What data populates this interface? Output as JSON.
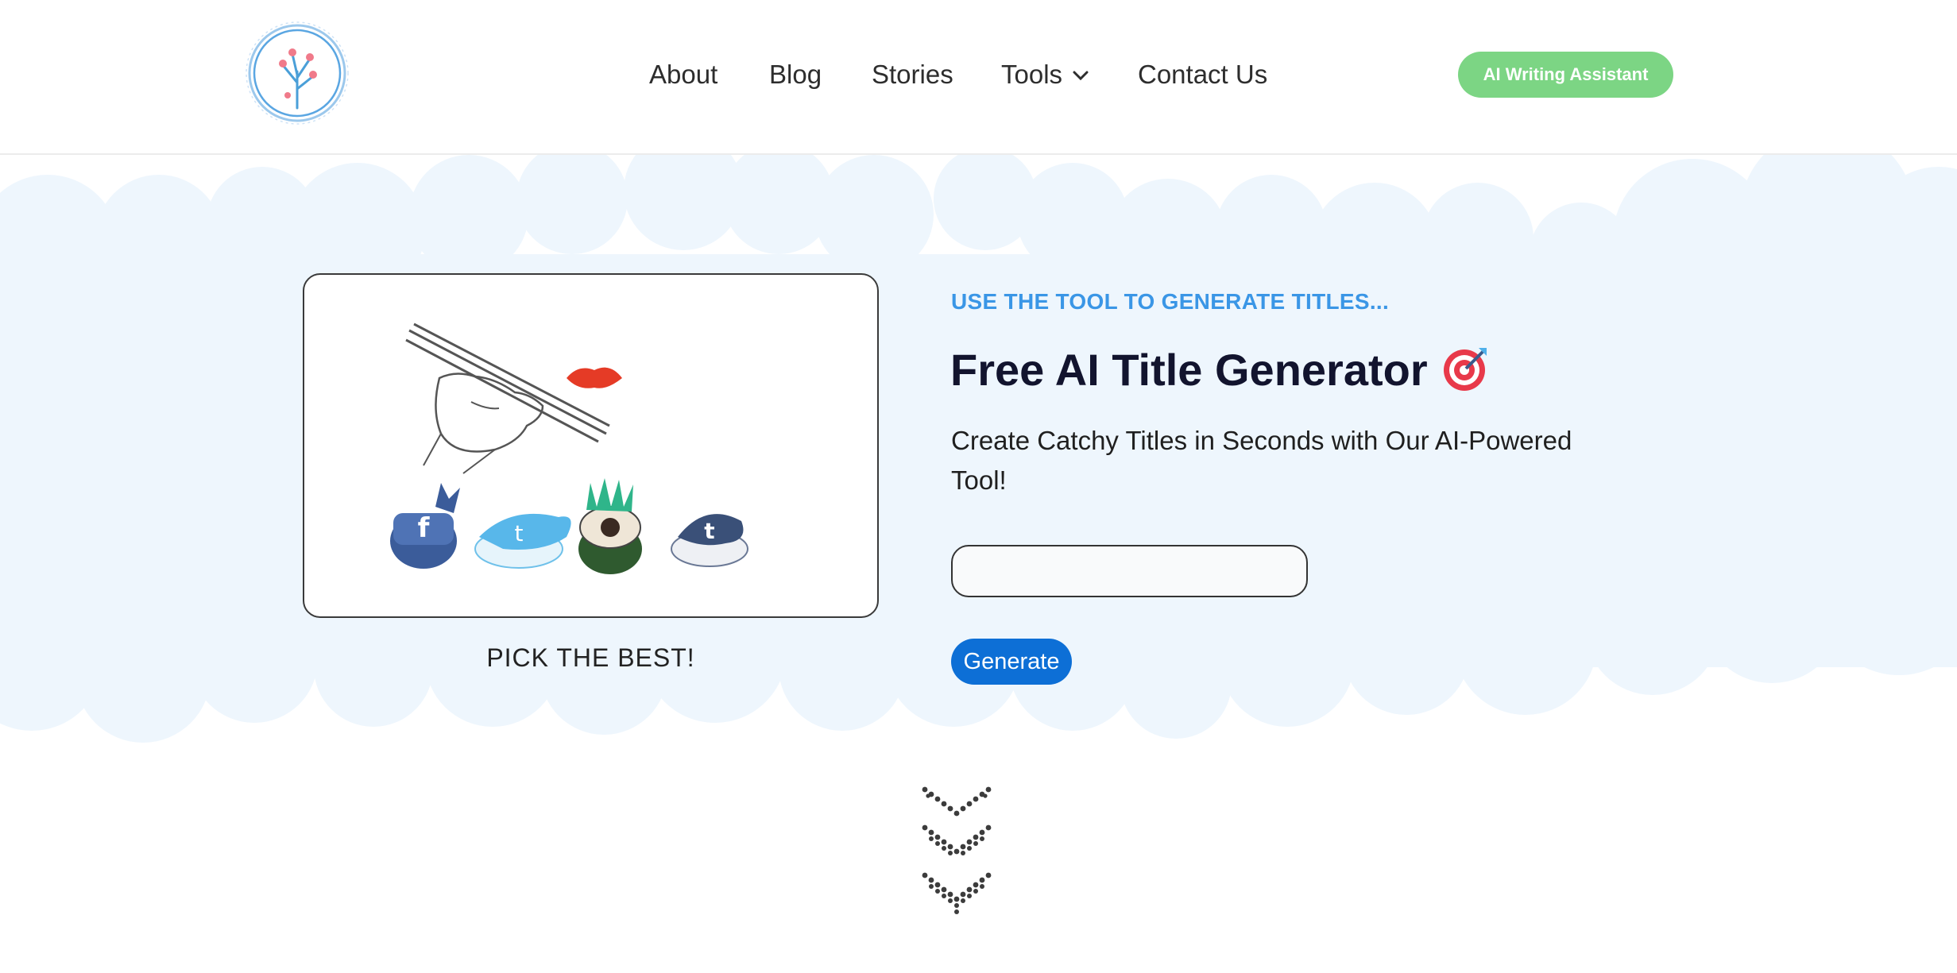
{
  "header": {
    "logo_icon": "tree-circle-logo",
    "nav": [
      {
        "label": "About"
      },
      {
        "label": "Blog"
      },
      {
        "label": "Stories"
      },
      {
        "label": "Tools",
        "icon": "chevron-down-icon"
      },
      {
        "label": "Contact Us"
      }
    ],
    "cta_label": "AI Writing Assistant",
    "cta_color": "#7cd584"
  },
  "hero": {
    "illustration": "chopsticks-picking-social-media-sushi",
    "caption": "PICK THE BEST!",
    "eyebrow": "USE THE TOOL TO GENERATE TITLES...",
    "title": "Free AI Title Generator",
    "title_icon": "target-icon",
    "subtitle": "Create Catchy Titles in Seconds with Our AI-Powered Tool!",
    "input_value": "",
    "generate_label": "Generate",
    "accent_color": "#3a96e6",
    "button_color": "#0d6fd6",
    "background_color": "#eef6fd"
  },
  "footer": {
    "scroll_icon": "triple-chevron-down-icon"
  }
}
